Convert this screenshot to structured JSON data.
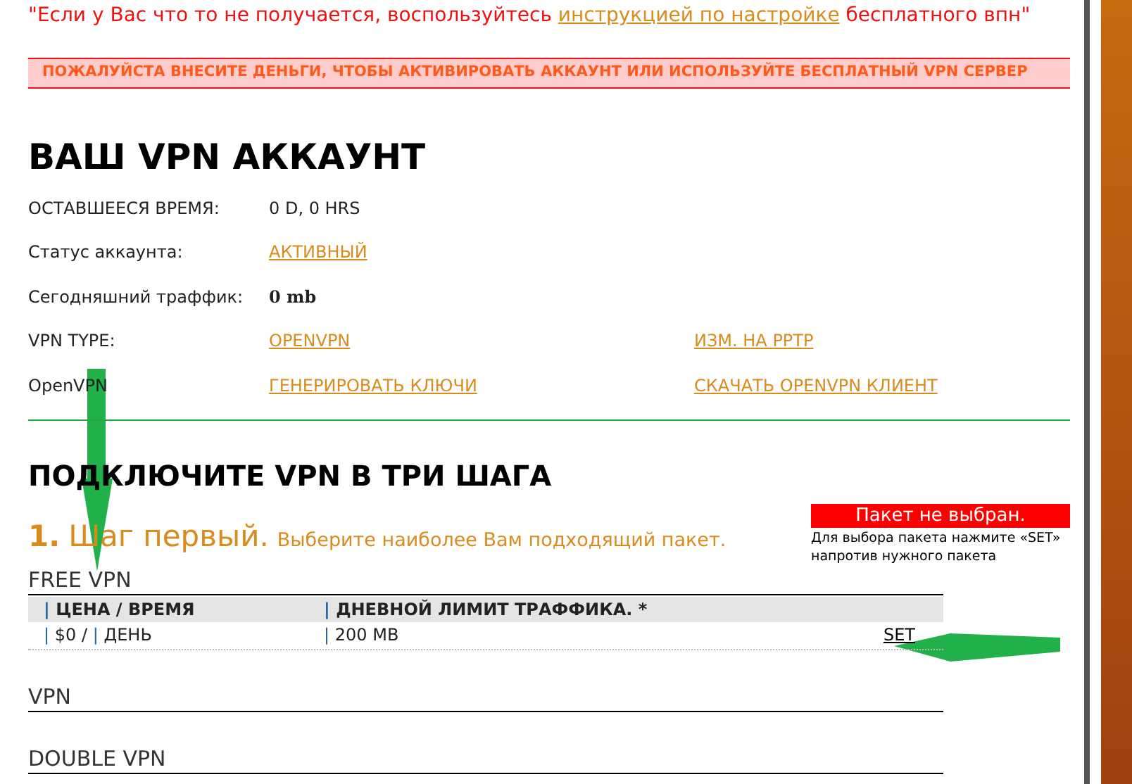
{
  "notice": {
    "prefix": "\"Если у Вас что то не получается, воспользуйтесь ",
    "link": "инструкцией по настройке",
    "suffix": " бесплатного впн\""
  },
  "banner": "ПОЖАЛУЙСТА ВНЕСИТЕ ДЕНЬГИ, ЧТОБЫ АКТИВИРОВАТЬ АККАУНТ ИЛИ ИСПОЛЬЗУЙТЕ БЕСПЛАТНЫЙ VPN СЕРВЕР",
  "account": {
    "title": "ВАШ VPN АККАУНТ",
    "rows": [
      {
        "label": "ОСТАВШЕЕСЯ ВРЕМЯ:",
        "value": "0 D, 0 HRS",
        "kind": "text"
      },
      {
        "label": "Статус аккаунта:",
        "value": "АКТИВНЫЙ",
        "kind": "link"
      },
      {
        "label": "Сегодняшний траффик:",
        "value": "0 mb",
        "kind": "bold"
      },
      {
        "label": "VPN TYPE:",
        "value": "OPENVPN",
        "kind": "link",
        "extra": "ИЗМ. НА PPTP"
      },
      {
        "label": "OpenVPN",
        "value": "ГЕНЕРИРОВАТЬ КЛЮЧИ",
        "kind": "link",
        "extra": "СКАЧАТЬ OPENVPN КЛИЕНТ"
      }
    ]
  },
  "setup": {
    "title": "ПОДКЛЮЧИТЕ VPN В ТРИ ШАГА",
    "step_number": "1.",
    "step_title": "Шаг первый.",
    "step_hint": "Выберите наиболее Вам подходящий пакет.",
    "status": "Пакет не выбран.",
    "status_hint": "Для выбора пакета нажмите «SET» напротив нужного пакета"
  },
  "packages": [
    {
      "name": "FREE VPN",
      "separator": "|",
      "columns": [
        "ЦЕНА / ВРЕМЯ",
        "ДНЕВНОЙ ЛИМИТ ТРАФФИКА. *"
      ],
      "rows": [
        {
          "price": "$0 /",
          "period": "ДЕНЬ",
          "limit": "200 MB",
          "action": "SET"
        }
      ]
    },
    {
      "name": "VPN"
    },
    {
      "name": "DOUBLE VPN"
    }
  ]
}
